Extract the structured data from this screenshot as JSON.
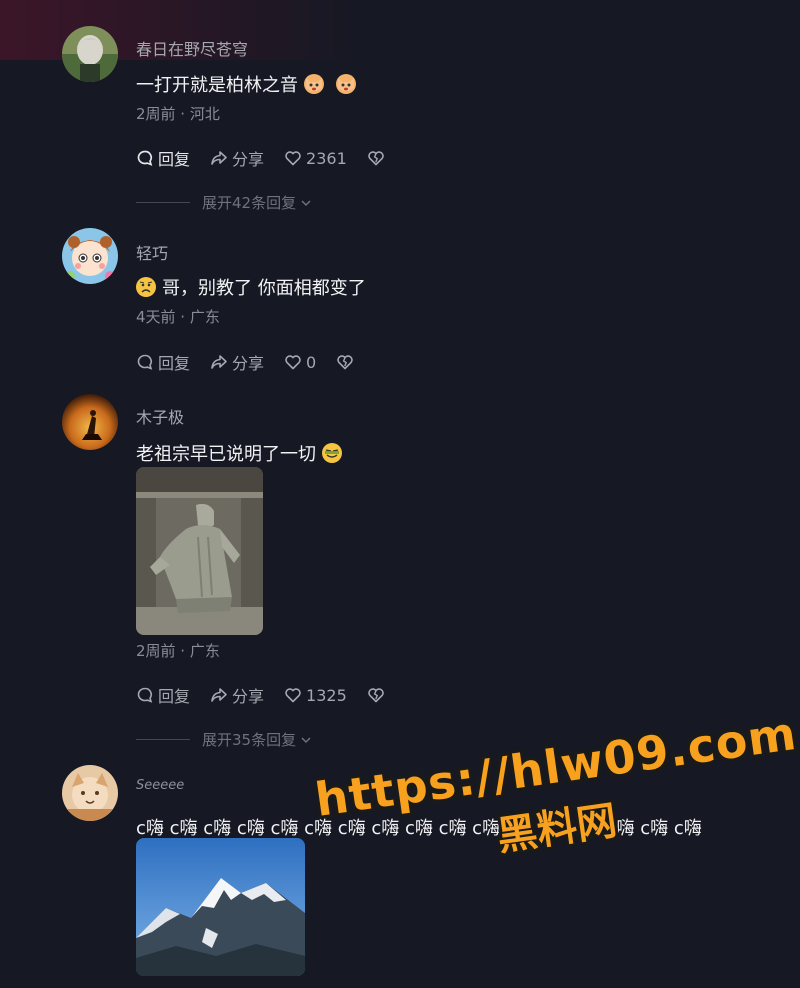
{
  "comments": [
    {
      "username": "春日在野尽苍穹",
      "text": "一打开就是柏林之音",
      "meta": "2周前 · 河北",
      "reply_label": "回复",
      "share_label": "分享",
      "likes": "2361",
      "expand_label": "展开42条回复",
      "emojis": [
        "cat-face-emoji",
        "cat-face-emoji"
      ]
    },
    {
      "username": "轻巧",
      "text": "哥，别教了 你面相都变了",
      "meta": "4天前 · 广东",
      "reply_label": "回复",
      "share_label": "分享",
      "likes": "0",
      "emojis": [
        "worried-face-emoji"
      ]
    },
    {
      "username": "木子极",
      "text": "老祖宗早已说明了一切",
      "meta": "2周前 · 广东",
      "reply_label": "回复",
      "share_label": "分享",
      "likes": "1325",
      "expand_label": "展开35条回复",
      "emojis": [
        "smirk-face-emoji"
      ]
    },
    {
      "username": "Seeeee",
      "text": "c嗨 c嗨 c嗨 c嗨 c嗨 c嗨 c嗨 c嗨 c嗨 c嗨 c嗨 c嗨 c嗨 c嗨 c嗨 c嗨 c嗨"
    }
  ],
  "watermark": {
    "url": "https://hlw09.com",
    "name": "黑料网"
  },
  "colors": {
    "background": "#161823",
    "primary_text": "#f2f2f4",
    "secondary_text": "#8a8c96",
    "watermark": "#f7a11e"
  }
}
